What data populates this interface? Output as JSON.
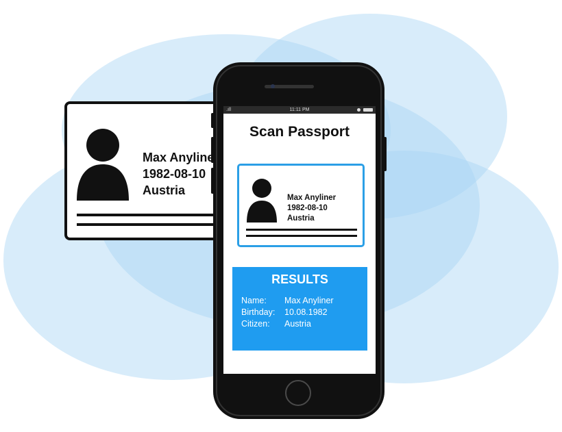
{
  "id_card": {
    "name": "Max  Anyliner",
    "birthday": "1982-08-10",
    "country": "Austria"
  },
  "phone": {
    "status_time": "11:11 PM",
    "screen_title": "Scan Passport",
    "scanned_card": {
      "name": "Max  Anyliner",
      "birthday": "1982-08-10",
      "country": "Austria"
    },
    "results": {
      "title": "RESULTS",
      "rows": [
        {
          "label": "Name:",
          "value": "Max Anyliner"
        },
        {
          "label": "Birthday:",
          "value": "10.08.1982"
        },
        {
          "label": "Citizen:",
          "value": "Austria"
        }
      ]
    }
  },
  "colors": {
    "blob": "#a9d4f5",
    "accent": "#1f9cf0",
    "card_border": "#2b9fe6",
    "phone_body": "#111111"
  }
}
